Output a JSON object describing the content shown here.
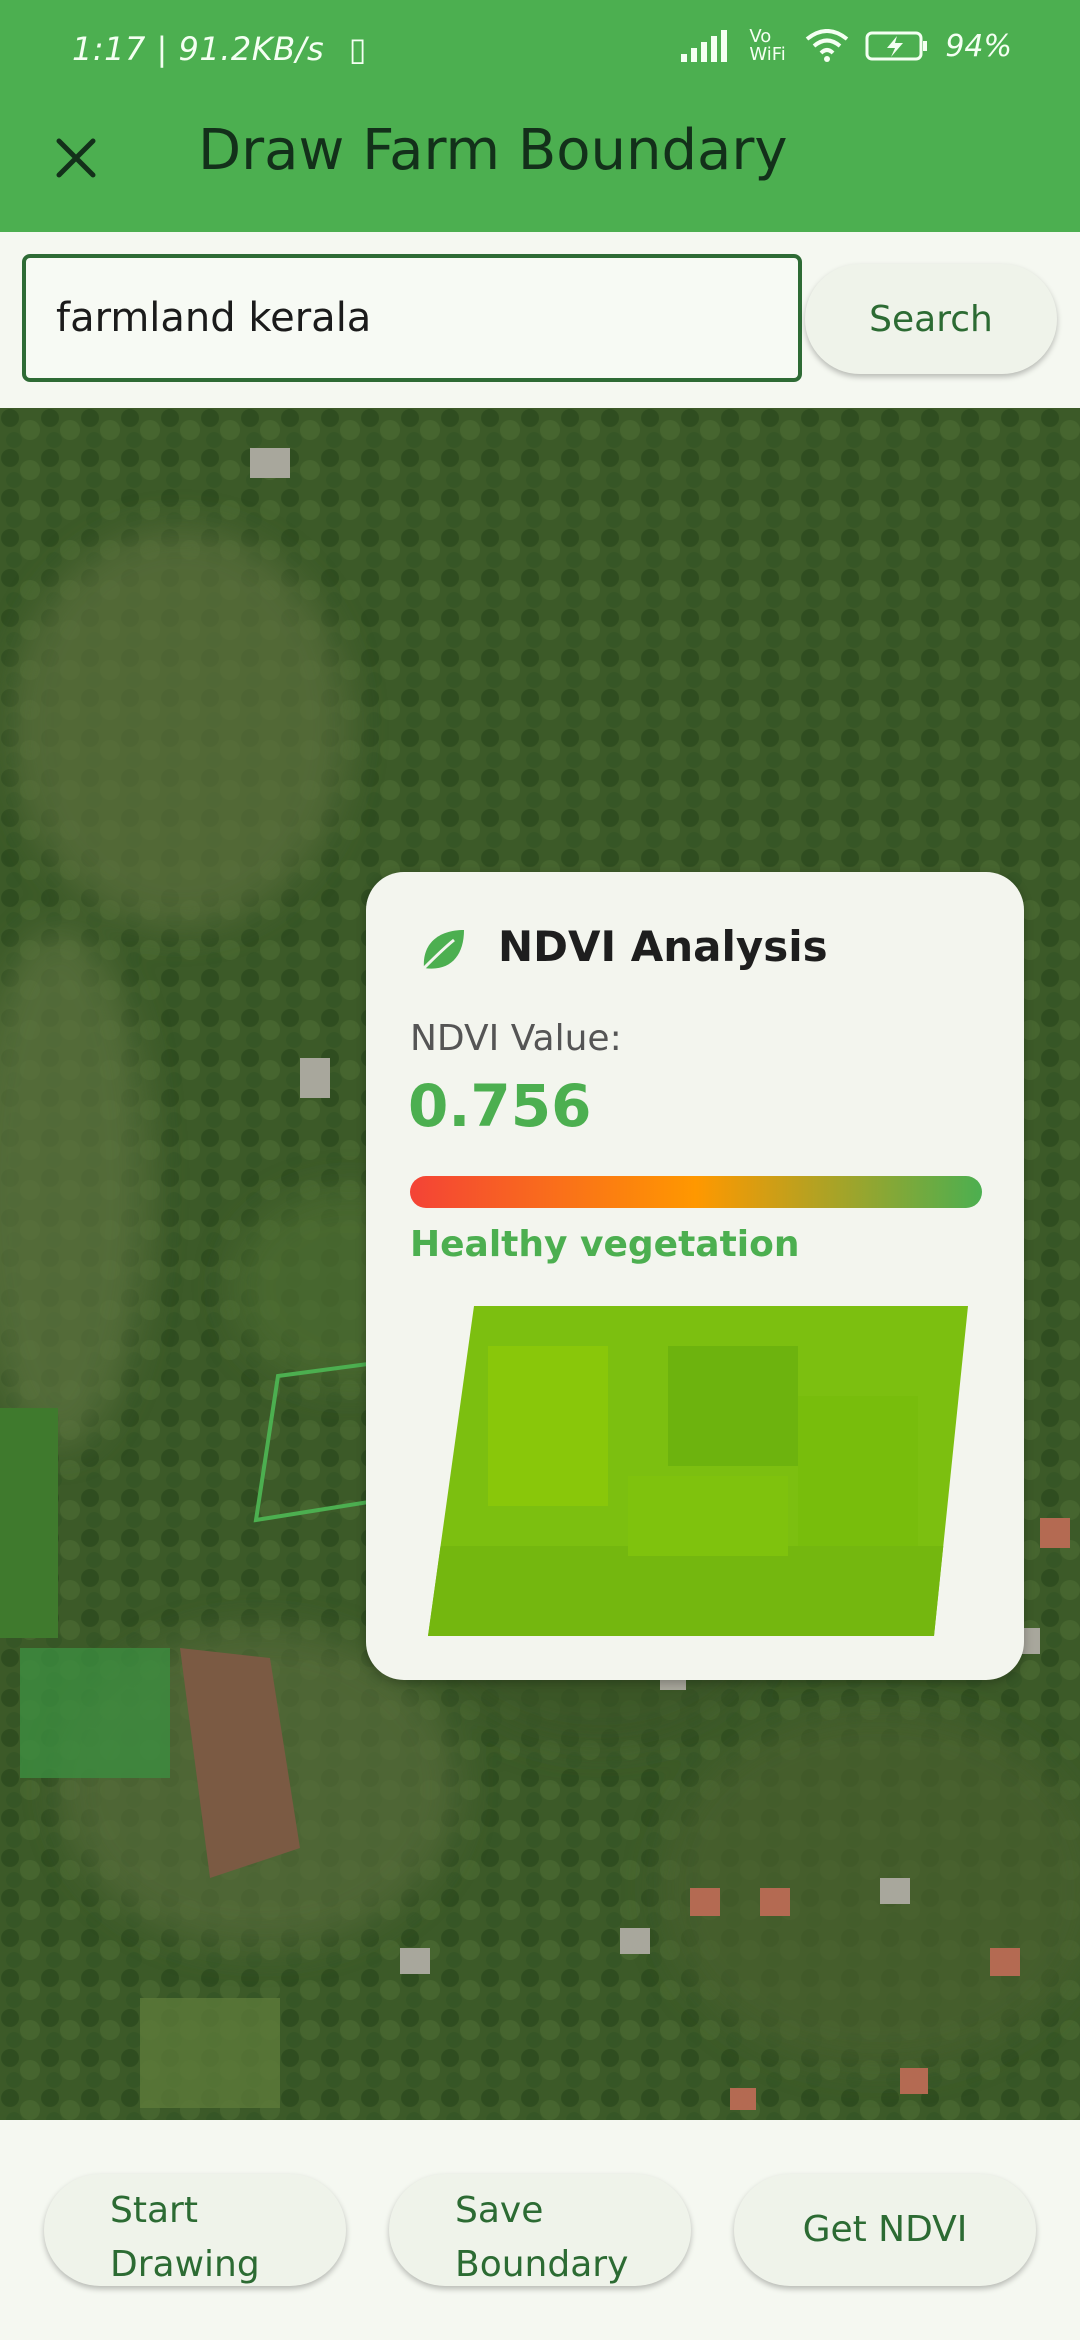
{
  "status_bar": {
    "time": "1:17",
    "network_speed": "91.2KB/s",
    "vo_wifi": "Vo WiFi",
    "battery": "94%"
  },
  "app_bar": {
    "title": "Draw Farm Boundary",
    "close_icon": "close-icon"
  },
  "search": {
    "value": "farmland kerala",
    "button_label": "Search"
  },
  "ndvi_card": {
    "title": "NDVI Analysis",
    "label": "NDVI Value:",
    "value": "0.756",
    "status": "Healthy vegetation",
    "icon": "leaf-icon",
    "colors": {
      "accent": "#4caf50",
      "scale_low": "#f44336",
      "scale_mid": "#ff9800",
      "scale_high": "#4caf50"
    }
  },
  "bottom_bar": {
    "start_drawing": "Start Drawing",
    "save_boundary": "Save Boundary",
    "get_ndvi": "Get NDVI"
  },
  "colors": {
    "app_bar": "#4caf50",
    "background": "#f5f8f1",
    "button_text": "#2c6b33"
  }
}
